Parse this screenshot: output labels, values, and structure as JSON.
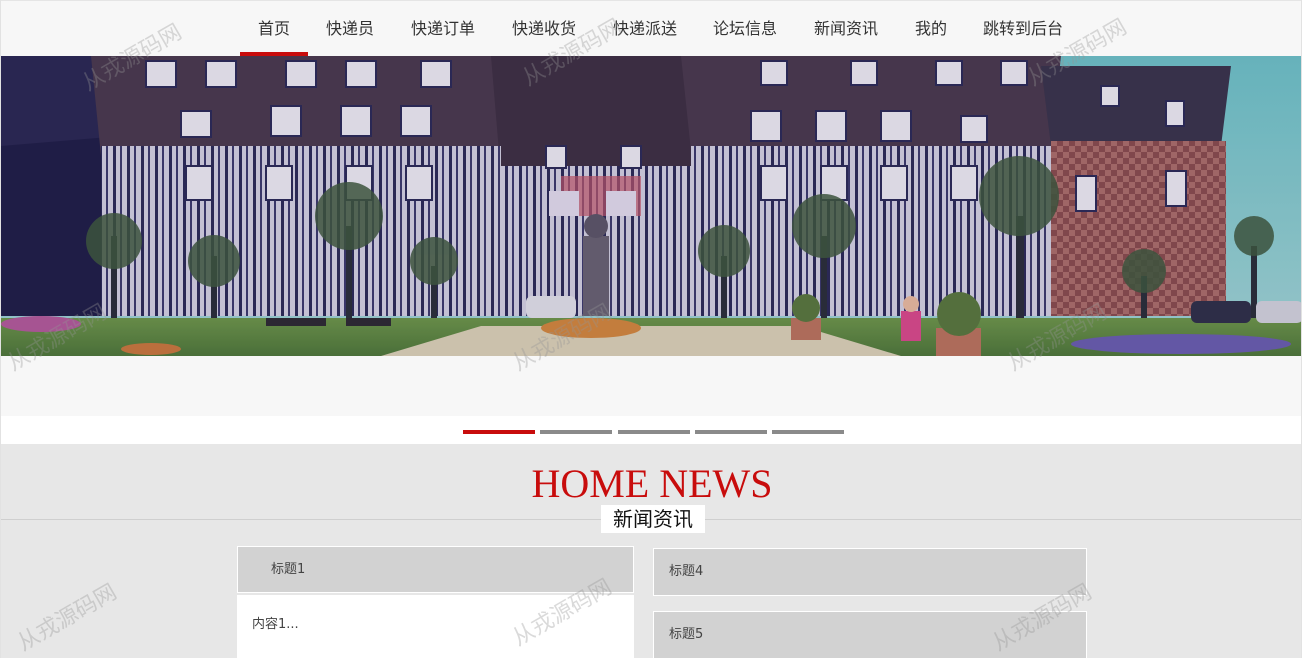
{
  "nav": {
    "items": [
      {
        "label": "首页",
        "active": true
      },
      {
        "label": "快递员"
      },
      {
        "label": "快递订单"
      },
      {
        "label": "快递收货"
      },
      {
        "label": "快递派送"
      },
      {
        "label": "论坛信息"
      },
      {
        "label": "新闻资讯"
      },
      {
        "label": "我的"
      },
      {
        "label": "跳转到后台"
      }
    ],
    "accent_color": "#c80c0c"
  },
  "banner": {
    "image": "half-timbered-manor-with-garden-photo",
    "slides": 5,
    "active_slide": 1
  },
  "news": {
    "title_en": "HOME NEWS",
    "title_cn": "新闻资讯",
    "items": [
      {
        "title": "标题1",
        "content": "内容1..."
      },
      {
        "title": "标题4"
      },
      {
        "title": "标题5"
      }
    ]
  },
  "watermark": "从戎源码网"
}
